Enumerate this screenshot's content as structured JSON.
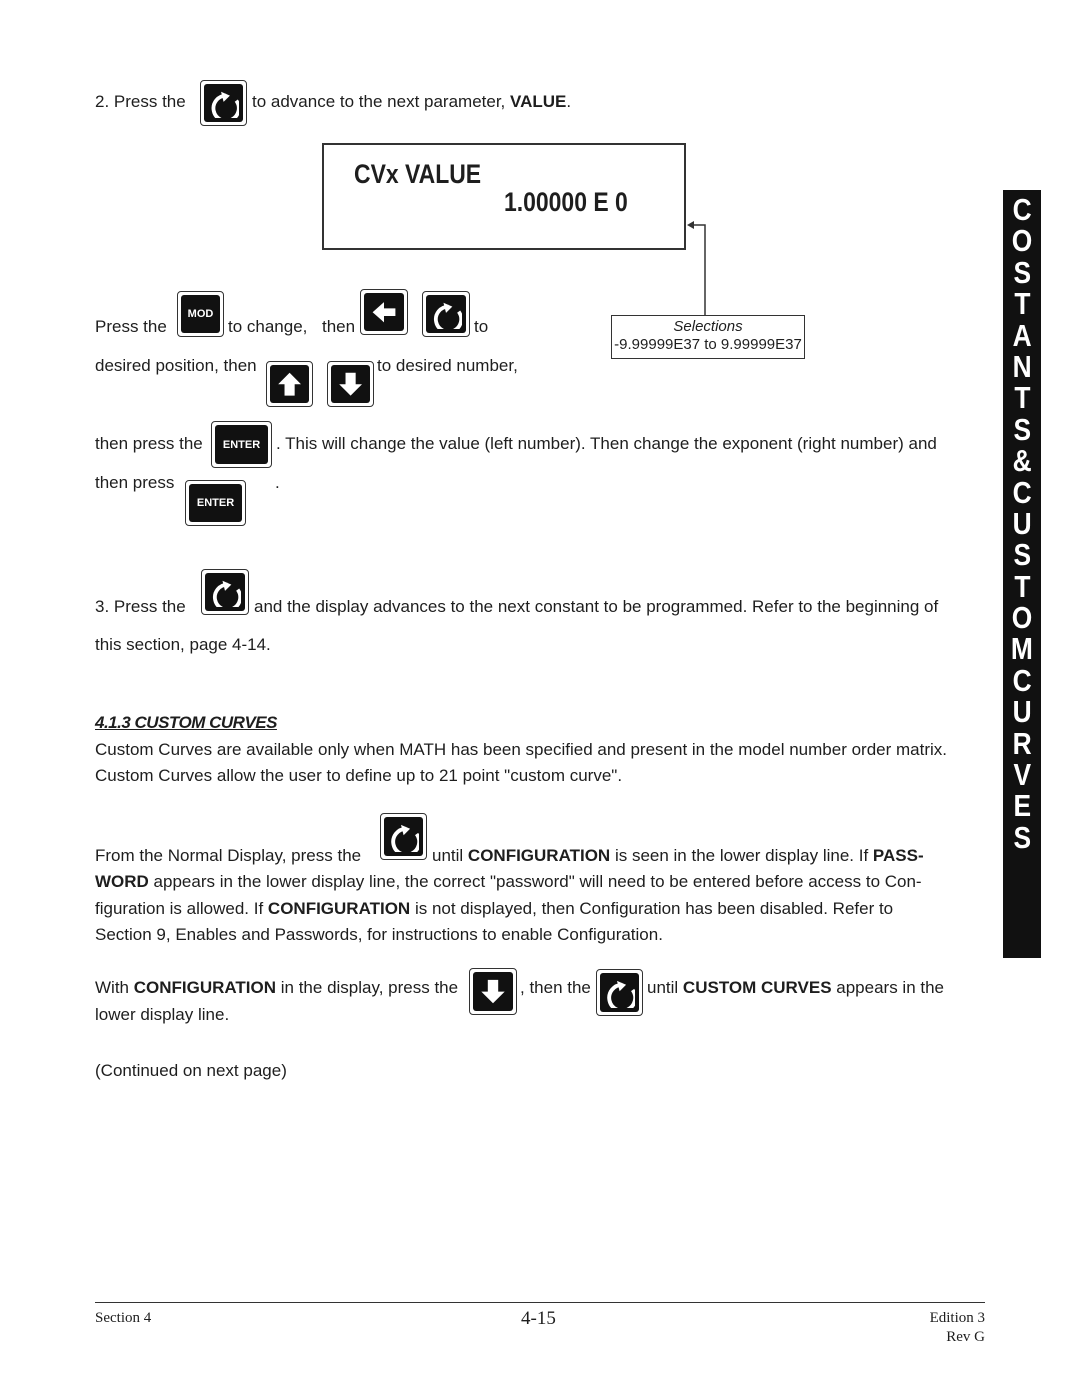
{
  "step2": {
    "prefix": "2.  Press the",
    "suffix_a": "to advance to the next parameter, ",
    "suffix_b": "VALUE",
    "suffix_c": "."
  },
  "display": {
    "line1": "CVx  VALUE",
    "line2": "1.00000  E  0"
  },
  "selections": {
    "title": "Selections",
    "range": "-9.99999E37 to 9.99999E37"
  },
  "edit": {
    "l1a": "Press the",
    "l1b": "to change,",
    "l1c": "then",
    "l1d": "to",
    "l2a": "desired position, then",
    "l2b": "to desired number,",
    "l3a": "then press the",
    "l3b": ".  This will change the value (left number).  Then change the exponent (right number) and",
    "l4a": "then  press",
    "l4b": "."
  },
  "keys": {
    "mod": "MOD",
    "enter": "ENTER"
  },
  "step3": {
    "a": "3.  Press the",
    "b": "and the display advances to the next constant to be programmed.  Refer to the beginning of",
    "c": "this section, page 4-14."
  },
  "section": {
    "heading": "4.1.3  CUSTOM CURVES",
    "p1": "Custom Curves are available only when MATH has been specified and present in the model number order matrix.",
    "p2": "Custom Curves allow the user to define up to 21 point \"custom curve\"."
  },
  "from": {
    "a": "From the Normal Display, press the",
    "b": "until ",
    "c": "CONFIGURATION",
    "d": " is seen in the lower display line.  If  ",
    "e": "PASS-",
    "l2a": "WORD",
    "l2b": " appears in the lower display line, the correct \"password\"  will need to be entered before access to Con-",
    "l3a": "figuration is allowed.  If ",
    "l3b": "CONFIGURATION",
    "l3c": " is not displayed, then Configuration has been disabled.  Refer to",
    "l4": "Section 9, Enables and Passwords, for instructions to enable Configuration."
  },
  "withconf": {
    "a": "With ",
    "b": "CONFIGURATION",
    "c": " in the display, press the",
    "d": ", then the",
    "e": "until ",
    "f": "CUSTOM CURVES",
    "g": " appears in the",
    "h": "lower display line."
  },
  "continued": "(Continued on next page)",
  "sidebar": {
    "letters": [
      "C",
      "O",
      "S",
      "T",
      "A",
      "N",
      "T",
      "S",
      "&",
      "C",
      "U",
      "S",
      "T",
      "O",
      "M",
      "C",
      "U",
      "R",
      "V",
      "E",
      "S"
    ]
  },
  "footer": {
    "left": "Section 4",
    "center": "4-15",
    "right1": "Edition 3",
    "right2": "Rev  G"
  }
}
